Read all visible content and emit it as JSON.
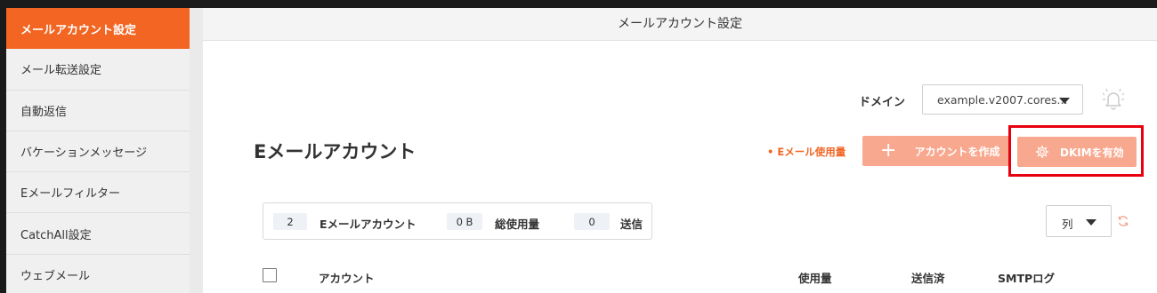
{
  "header": {
    "title": "メールアカウント設定"
  },
  "sidebar": {
    "items": [
      {
        "label": "メールアカウント設定",
        "active": true
      },
      {
        "label": "メール転送設定"
      },
      {
        "label": "自動返信"
      },
      {
        "label": "バケーションメッセージ"
      },
      {
        "label": "Eメールフィルター"
      },
      {
        "label": "CatchAll設定"
      },
      {
        "label": "ウェブメール"
      }
    ]
  },
  "domain": {
    "label": "ドメイン",
    "value": "example.v2007.cores..."
  },
  "section": {
    "title": "Eメールアカウント",
    "usage_link": "• Eメール使用量",
    "create_label": "アカウントを作成",
    "dkim_label": "DKIMを有効"
  },
  "stats": {
    "accounts_count": "2",
    "accounts_label": "Eメールアカウント",
    "usage_value": "0 B",
    "usage_label": "総使用量",
    "sent_count": "0",
    "sent_label": "送信"
  },
  "columns_button": {
    "label": "列"
  },
  "table": {
    "headers": {
      "account": "アカウント",
      "usage": "使用量",
      "sent": "送信済",
      "smtp_log": "SMTPログ"
    }
  },
  "colors": {
    "accent": "#f26522",
    "button": "#f8a88e",
    "highlight": "#e8000f"
  },
  "icons": {
    "bell": "bell-ringing-icon",
    "gear": "gear-icon",
    "refresh": "refresh-icon",
    "caret": "chevron-down-icon"
  }
}
